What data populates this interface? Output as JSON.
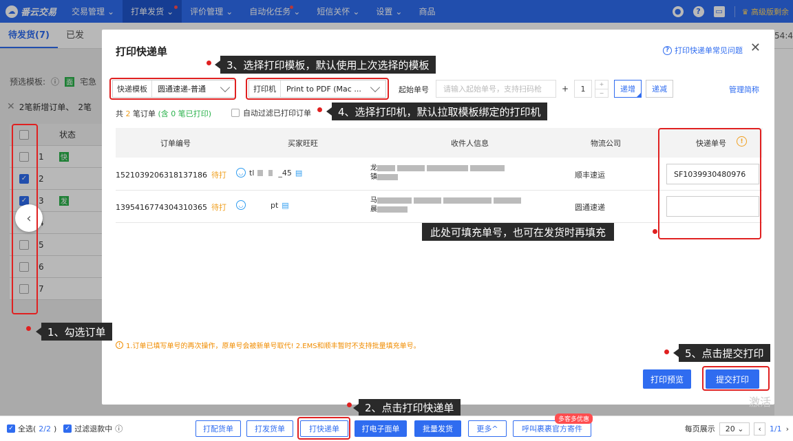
{
  "nav": {
    "logo": "番云交易",
    "items": [
      {
        "label": "交易管理",
        "active": false,
        "dot": false
      },
      {
        "label": "打单发货",
        "active": true,
        "dot": true
      },
      {
        "label": "评价管理",
        "active": false,
        "dot": false
      },
      {
        "label": "自动化任务",
        "active": false,
        "dot": true
      },
      {
        "label": "短信关怀",
        "active": false,
        "dot": false
      },
      {
        "label": "设置",
        "active": false,
        "dot": false
      },
      {
        "label": "商品",
        "active": false,
        "dot": false
      }
    ],
    "vip": "高级版剩余"
  },
  "page": {
    "tabs": [
      "待发货(7)",
      "已发"
    ],
    "clock": "54:4",
    "template_label": "预选模板:",
    "template_tag": "面",
    "template_value": "宅急",
    "new_orders": "2笔新增订单、",
    "new_orders2": "2笔",
    "rows": [
      {
        "num": "1",
        "checked": false,
        "tag": "快",
        "tag_color": "#2bb24c"
      },
      {
        "num": "2",
        "checked": true,
        "tag": "",
        "tag_color": ""
      },
      {
        "num": "3",
        "checked": true,
        "tag": "发",
        "tag_color": "#2bb24c"
      },
      {
        "num": "4",
        "checked": false,
        "tag": "",
        "tag_color": ""
      },
      {
        "num": "5",
        "checked": false,
        "tag": "",
        "tag_color": ""
      },
      {
        "num": "6",
        "checked": false,
        "tag": "",
        "tag_color": ""
      },
      {
        "num": "7",
        "checked": false,
        "tag": "",
        "tag_color": ""
      }
    ],
    "header_status": "状态"
  },
  "modal": {
    "title": "打印快递单",
    "help": "打印快递单常见问题",
    "template_label": "快递模板",
    "template_value": "圆通速递-普通",
    "printer_label": "打印机",
    "printer_value": "Print to PDF (Mac ...",
    "start_label": "起始单号",
    "start_placeholder": "请输入起始单号，支持扫码枪",
    "plus": "+",
    "qty": "1",
    "increment": "递增",
    "decrement": "递减",
    "manage": "管理简称",
    "count_prefix": "共",
    "count_num": "2",
    "count_mid": "笔订单",
    "count_printed": "(含 0 笔已打印)",
    "auto_filter": "自动过滤已打印订单",
    "columns": [
      "订单编号",
      "买家旺旺",
      "收件人信息",
      "物流公司",
      "快递单号"
    ],
    "orders": [
      {
        "order_no": "1521039206318137186",
        "status": "待打",
        "buyer": "tl",
        "buyer_tail": "_45",
        "recv1": "龙",
        "recv2": "镇",
        "logistics": "顺丰速运",
        "tracking": "SF1039930480976"
      },
      {
        "order_no": "1395416774304310365",
        "status": "待打",
        "buyer": "",
        "buyer_tail": "pt",
        "recv1": "马",
        "recv2": "晨",
        "logistics": "圆通速递",
        "tracking": ""
      }
    ],
    "warning": "1.订单已填写单号的再次操作，原单号会被新单号取代! 2.EMS和顺丰暂时不支持批量填充单号。",
    "preview": "打印预览",
    "submit": "提交打印"
  },
  "bottom": {
    "select_all": "全选(",
    "selected": "2/2",
    "select_all_end": ")",
    "filter_refund": "过滤退款中",
    "buttons": [
      "打配货单",
      "打发货单",
      "打快递单",
      "打电子面单",
      "批量发货",
      "更多^",
      "呼叫裹裹官方寄件"
    ],
    "promo": "多客多优惠",
    "page_size_label": "每页展示",
    "page_size": "20",
    "pager": "1/1"
  },
  "annotations": {
    "step1": "1、勾选订单",
    "step2": "2、点击打印快递单",
    "step3": "3、选择打印模板，默认使用上次选择的模板",
    "step4": "4、选择打印机，默认拉取模板绑定的打印机",
    "step5": "5、点击提交打印",
    "note": "此处可填充单号，也可在发货时再填充"
  },
  "watermark": "激活",
  "colors": {
    "primary": "#2f6cf0",
    "annotation": "#e02020",
    "pending": "#f0a020"
  }
}
